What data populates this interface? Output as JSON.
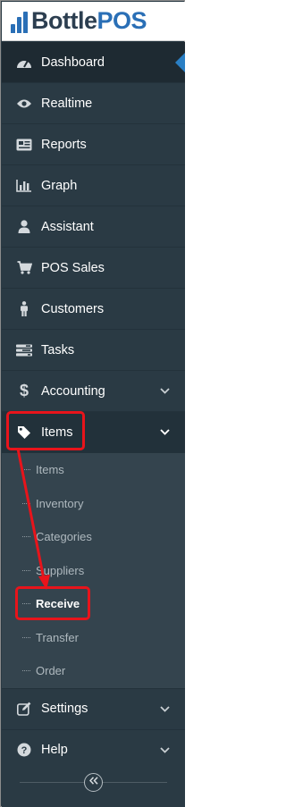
{
  "logo": {
    "word1": "Bottle",
    "word2": "POS"
  },
  "nav": {
    "dashboard": "Dashboard",
    "realtime": "Realtime",
    "reports": "Reports",
    "graph": "Graph",
    "assistant": "Assistant",
    "pos_sales": "POS Sales",
    "customers": "Customers",
    "tasks": "Tasks",
    "accounting": "Accounting",
    "items": "Items",
    "settings": "Settings",
    "help": "Help"
  },
  "items_submenu": [
    "Items",
    "Inventory",
    "Categories",
    "Suppliers",
    "Receive",
    "Transfer",
    "Order"
  ],
  "colors": {
    "annotation": "#e8141b",
    "active_indicator": "#2a7fc4",
    "brand_blue": "#2a6fb6"
  }
}
